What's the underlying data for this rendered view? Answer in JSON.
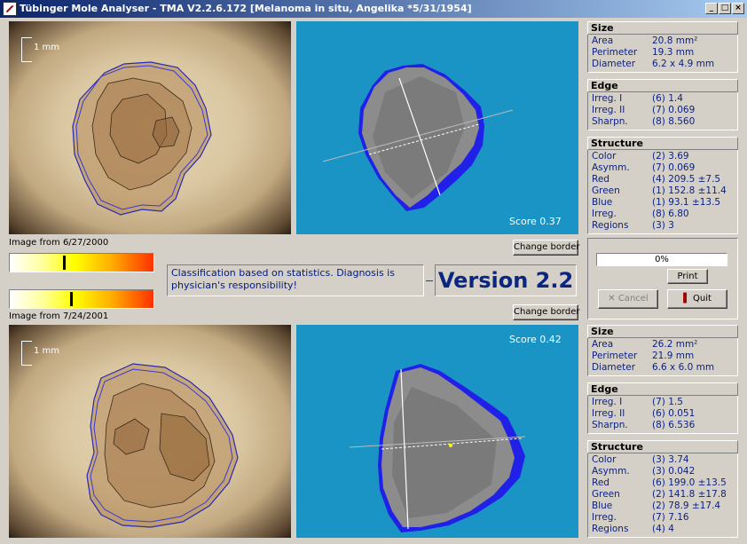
{
  "window": {
    "title": "Tübinger Mole Analyser - TMA V2.2.6.172  [Melanoma in situ, Angelika  *5/31/1954]",
    "minimize": "_",
    "maximize": "□",
    "close": "×"
  },
  "top": {
    "scale_label": "1 mm",
    "score_label": "Score  0.37",
    "date_label": "Image from 6/27/2000",
    "change_border": "Change border",
    "marker_fraction": 0.37
  },
  "bottom": {
    "scale_label": "1 mm",
    "score_label": "Score  0.42",
    "date_label": "Image from 7/24/2001",
    "change_border": "Change border",
    "marker_fraction": 0.42
  },
  "classification_text": "Classification based on statistics. Diagnosis is physician's responsibility!",
  "version_text": "Version 2.2",
  "controls": {
    "progress_text": "0%",
    "print": "Print",
    "cancel": "Cancel",
    "quit": "Quit"
  },
  "top_stats": {
    "size": {
      "title": "Size",
      "rows": [
        {
          "k": "Area",
          "v": "20.8 mm²"
        },
        {
          "k": "Perimeter",
          "v": "19.3 mm"
        },
        {
          "k": "Diameter",
          "v": "6.2 x 4.9 mm"
        }
      ]
    },
    "edge": {
      "title": "Edge",
      "rows": [
        {
          "k": "Irreg. I",
          "v": "(6) 1.4"
        },
        {
          "k": "Irreg. II",
          "v": "(7) 0.069"
        },
        {
          "k": "Sharpn.",
          "v": "(8) 8.560"
        }
      ]
    },
    "structure": {
      "title": "Structure",
      "rows": [
        {
          "k": "Color",
          "v": "(2) 3.69"
        },
        {
          "k": "Asymm.",
          "v": "(7) 0.069"
        },
        {
          "k": "Red",
          "v": "(4) 209.5  ±7.5"
        },
        {
          "k": "Green",
          "v": "(1) 152.8  ±11.4"
        },
        {
          "k": "Blue",
          "v": "(1) 93.1  ±13.5"
        },
        {
          "k": "Irreg.",
          "v": "(8) 6.80"
        },
        {
          "k": "Regions",
          "v": "(3) 3"
        }
      ]
    }
  },
  "bottom_stats": {
    "size": {
      "title": "Size",
      "rows": [
        {
          "k": "Area",
          "v": "26.2 mm²"
        },
        {
          "k": "Perimeter",
          "v": "21.9 mm"
        },
        {
          "k": "Diameter",
          "v": "6.6 x 6.0 mm"
        }
      ]
    },
    "edge": {
      "title": "Edge",
      "rows": [
        {
          "k": "Irreg. I",
          "v": "(7) 1.5"
        },
        {
          "k": "Irreg. II",
          "v": "(6) 0.051"
        },
        {
          "k": "Sharpn.",
          "v": "(8) 6.536"
        }
      ]
    },
    "structure": {
      "title": "Structure",
      "rows": [
        {
          "k": "Color",
          "v": "(3) 3.74"
        },
        {
          "k": "Asymm.",
          "v": "(3) 0.042"
        },
        {
          "k": "Red",
          "v": "(6) 199.0  ±13.5"
        },
        {
          "k": "Green",
          "v": "(2) 141.8  ±17.8"
        },
        {
          "k": "Blue",
          "v": "(2) 78.9  ±17.4"
        },
        {
          "k": "Irreg.",
          "v": "(7) 7.16"
        },
        {
          "k": "Regions",
          "v": "(4) 4"
        }
      ]
    }
  },
  "colors": {
    "panel_blue": "#1a94c4",
    "text_blue": "#0a1f80",
    "title_bar": "#0a246a"
  }
}
